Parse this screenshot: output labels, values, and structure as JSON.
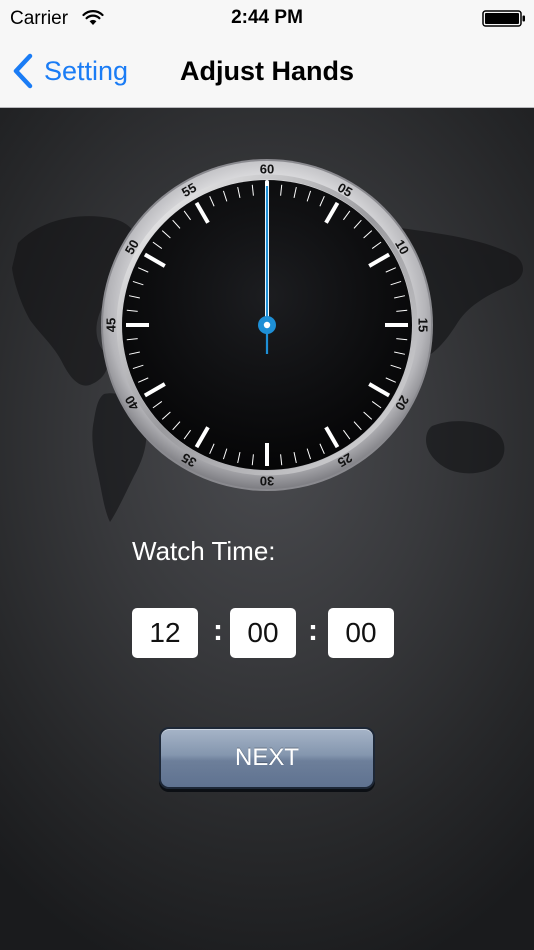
{
  "status_bar": {
    "carrier": "Carrier",
    "time": "2:44 PM",
    "icons": [
      "wifi-icon",
      "battery-icon"
    ]
  },
  "nav": {
    "back_label": "Setting",
    "back_icon": "back-chevron-icon",
    "title": "Adjust Hands",
    "accent_color": "#1a7cf5"
  },
  "watch": {
    "bezel_labels": [
      "60",
      "05",
      "10",
      "15",
      "20",
      "25",
      "30",
      "35",
      "40",
      "45",
      "50",
      "55"
    ],
    "hand_color": "#1e8fd6"
  },
  "time_entry": {
    "label": "Watch Time:",
    "hours": "12",
    "minutes": "00",
    "seconds": "00",
    "separator": ":"
  },
  "next_button": {
    "label": "NEXT"
  }
}
